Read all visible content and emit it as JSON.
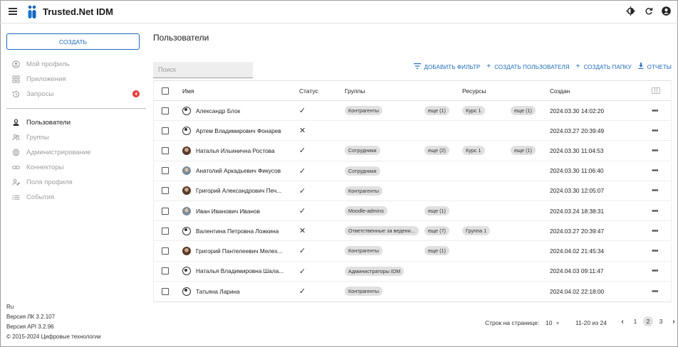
{
  "app": {
    "title": "Trusted.Net IDM"
  },
  "sidebar": {
    "create_label": "СОЗДАТЬ",
    "top_items": [
      {
        "label": "Мой профиль",
        "icon": "profile-icon"
      },
      {
        "label": "Приложения",
        "icon": "apps-icon"
      },
      {
        "label": "Запросы",
        "icon": "history-icon",
        "badge": "4"
      }
    ],
    "admin_items": [
      {
        "label": "Пользователи",
        "icon": "user-icon",
        "active": true
      },
      {
        "label": "Группы",
        "icon": "groups-icon"
      },
      {
        "label": "Администрирование",
        "icon": "gear-icon"
      },
      {
        "label": "Коннекторы",
        "icon": "link-icon"
      },
      {
        "label": "Поля профиля",
        "icon": "profile-fields-icon"
      },
      {
        "label": "События",
        "icon": "events-icon"
      }
    ],
    "footer": {
      "lang": "Ru",
      "version_lk": "Версия ЛК 3.2.107",
      "version_api": "Версия API 3.2.96",
      "copyright": "© 2015-2024 Цифровые технологии"
    }
  },
  "main": {
    "title": "Пользователи",
    "search_placeholder": "Поиск",
    "actions": [
      {
        "label": "ДОБАВИТЬ ФИЛЬТР",
        "icon": "filter-icon"
      },
      {
        "label": "СОЗДАТЬ ПОЛЬЗОВАТЕЛЯ",
        "icon": "plus-icon"
      },
      {
        "label": "СОЗДАТЬ ПАПКУ",
        "icon": "plus-icon"
      },
      {
        "label": "ОТЧЕТЫ",
        "icon": "download-icon"
      }
    ],
    "columns": {
      "name": "Имя",
      "status": "Статус",
      "groups": "Группы",
      "resources": "Ресурсы",
      "created": "Создан"
    },
    "rows": [
      {
        "name": "Александр Блок",
        "avatar": "generic",
        "status": "active",
        "group": "Контрагенты",
        "groups_more": "еще (1)",
        "resource": "Курс 1",
        "resources_more": "еще (1)",
        "created": "2024.03.30 14:02:20"
      },
      {
        "name": "Артем Владимирович Фонарев",
        "avatar": "generic",
        "status": "blocked",
        "group": "",
        "groups_more": "",
        "resource": "",
        "resources_more": "",
        "created": "2024.03.27 20:39:49"
      },
      {
        "name": "Наталья Ильинична Ростова",
        "avatar": "photo",
        "status": "active",
        "group": "Сотрудники",
        "groups_more": "еще (2)",
        "resource": "Курс 1",
        "resources_more": "еще (1)",
        "created": "2024.03.30 11:04:53"
      },
      {
        "name": "Анатолий Аркадьевич Фикусов",
        "avatar": "photo2",
        "status": "active",
        "group": "Сотрудники",
        "groups_more": "",
        "resource": "",
        "resources_more": "",
        "created": "2024.03.30 11:06:40"
      },
      {
        "name": "Григорий Александрович Печ...",
        "avatar": "photo",
        "status": "active",
        "group": "Контрагенты",
        "groups_more": "",
        "resource": "",
        "resources_more": "",
        "created": "2024.03.30 12:05:07"
      },
      {
        "name": "Иван Иванович Иванов",
        "avatar": "photo2",
        "status": "active",
        "group": "Moodle-admins",
        "groups_more": "еще (1)",
        "resource": "",
        "resources_more": "",
        "created": "2024.03.24 18:38:31"
      },
      {
        "name": "Валентина Петровна Ложкина",
        "avatar": "generic",
        "status": "blocked",
        "group": "Ответственные за ведени...",
        "groups_more": "еще (7)",
        "resource": "Группа 1",
        "resources_more": "",
        "created": "2024.03.27 20:39:47"
      },
      {
        "name": "Григорий Пантелеевич Мелех...",
        "avatar": "photo",
        "status": "active",
        "group": "Контрагенты",
        "groups_more": "еще (1)",
        "resource": "",
        "resources_more": "",
        "created": "2024.04.02 21:45:34"
      },
      {
        "name": "Наталья Владимировна Шала...",
        "avatar": "generic",
        "status": "active",
        "group": "Администраторы IDM",
        "groups_more": "",
        "resource": "",
        "resources_more": "",
        "created": "2024.04.03 09:11:47"
      },
      {
        "name": "Татьяна Ларина",
        "avatar": "generic",
        "status": "active",
        "group": "Контрагенты",
        "groups_more": "",
        "resource": "",
        "resources_more": "",
        "created": "2024.04.02 22:18:00"
      }
    ],
    "pagination": {
      "rows_per_page_label": "Строк на странице:",
      "rows_per_page": "10",
      "range": "11-20 из 24",
      "pages": [
        "1",
        "2",
        "3"
      ],
      "current_page": "2"
    }
  },
  "colors": {
    "accent": "#1e6bb8",
    "badge": "#e53935",
    "chip": "#e0e0e0"
  }
}
